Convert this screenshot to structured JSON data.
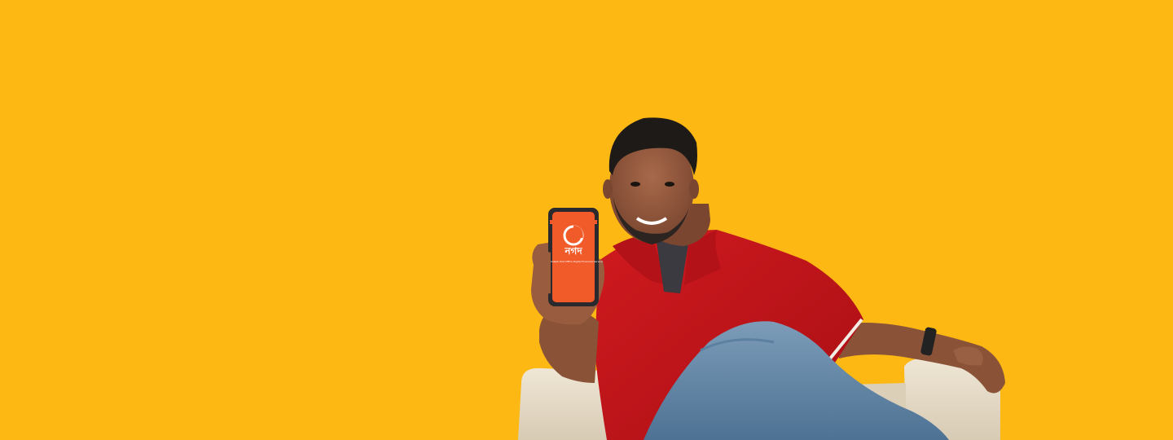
{
  "banner": {
    "background_color": "#FDB813",
    "alt": "Man in a red polo shirt sitting on an armchair holding a smartphone showing the Nagad app"
  },
  "phone": {
    "screen_color": "#F15A29",
    "app_logo_text": "নগদ",
    "app_tagline": "Bangladesh Post Office Digital Financial Service",
    "logo": "nagad-logo-icon"
  },
  "colors": {
    "shirt": "#C8151B",
    "jeans": "#6F92B0",
    "chair": "#E8DCC8",
    "skin": "#8A5338",
    "hair": "#1E1A18"
  }
}
